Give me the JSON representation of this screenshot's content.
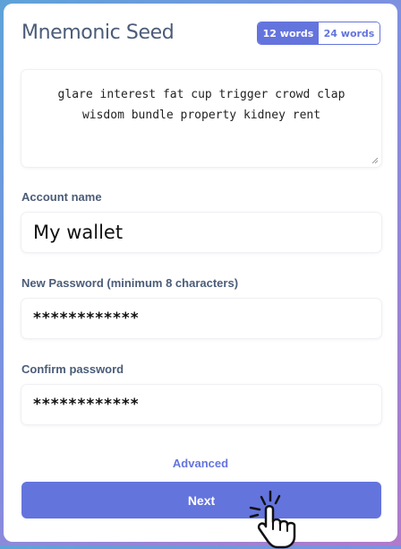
{
  "header": {
    "title": "Mnemonic Seed"
  },
  "word_toggle": {
    "options": [
      "12 words",
      "24 words"
    ],
    "selected": "12 words"
  },
  "seed": {
    "phrase": "glare interest fat cup trigger crowd clap wisdom bundle property kidney rent"
  },
  "account_name": {
    "label": "Account name",
    "value": "My wallet"
  },
  "new_password": {
    "label": "New Password (minimum 8 characters)",
    "value": "************"
  },
  "confirm_password": {
    "label": "Confirm password",
    "value": "************"
  },
  "advanced": {
    "label": "Advanced"
  },
  "next_button": {
    "label": "Next"
  },
  "colors": {
    "accent": "#6474dd",
    "label": "#4b5c78"
  },
  "cursor": {
    "icon": "hand-pointer-click-icon"
  }
}
